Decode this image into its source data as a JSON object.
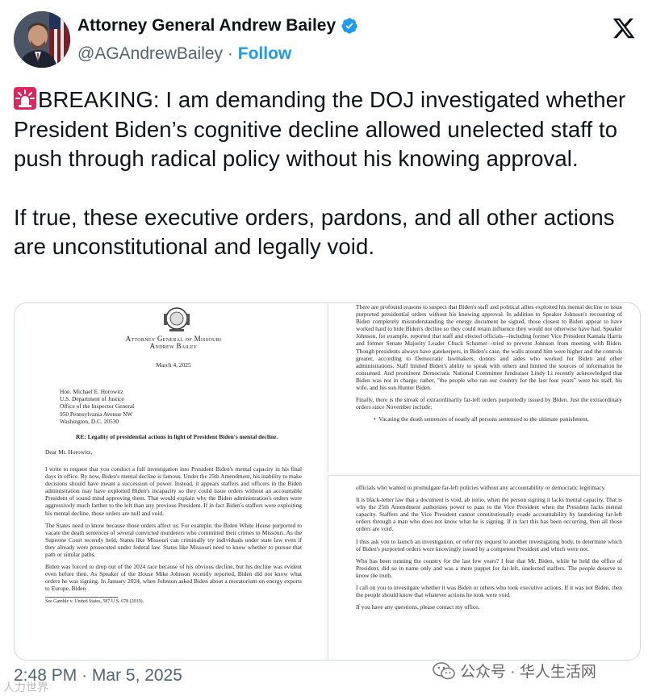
{
  "header": {
    "display_name": "Attorney General Andrew Bailey",
    "handle": "@AGAndrewBailey",
    "separator": "·",
    "follow_label": "Follow"
  },
  "tweet": {
    "paragraph1": "BREAKING: I am demanding the DOJ investigated whether President Biden’s cognitive decline allowed unelected staff to push through radical policy without his knowing approval.",
    "paragraph2": "If true, these executive orders, pardons, and all other actions are unconstitutional and legally void."
  },
  "letter": {
    "office_line1": "Attorney General of Missouri",
    "office_line2": "Andrew Bailey",
    "date": "March 4, 2025",
    "addressee": [
      "Hon. Michael E. Horowitz",
      "U.S. Department of Justice",
      "Office of the Inspector General",
      "950 Pennsylvania Avenue NW",
      "Washington, D.C. 20530"
    ],
    "re_line": "RE: Legality of presidential actions in light of President Biden's mental decline.",
    "salutation": "Dear Mr. Horowitz,",
    "left_paragraphs": [
      "I write to request that you conduct a full investigation into President Biden's mental capacity in his final days in office. By now, Biden's mental decline is famous. Under the 25th Amendment, his inability to make decisions should have meant a succession of power. Instead, it appears staffers and officers in the Biden administration may have exploited Biden's incapacity so they could issue orders without an accountable President of sound mind approving them. That would explain why the Biden administration's orders were aggressively much farther to the left than any previous President. If in fact Biden's staffers were exploiting his mental decline, those orders are null and void.",
      "The States need to know because those orders affect us. For example, the Biden White House purported to vacate the death sentences of several convicted murderers who committed their crimes in Missouri. As the Supreme Court recently held, States like Missouri can criminally try individuals under state law even if they already were prosecuted under federal law. States like Missouri need to know whether to pursue that path or similar paths.",
      "Biden was forced to drop out of the 2024 race because of his obvious decline, but his decline was evident even before then. As Speaker of the House Mike Johnson recently reported, Biden did not know what orders he was signing. In January 2024, when Johnson asked Biden about a moratorium on energy exports to Europe, Biden"
    ],
    "footnote": "See Gamble v. United States, 587 U.S. 678 (2019).",
    "top_right_paragraphs": [
      "There are profound reasons to suspect that Biden's staff and political allies exploited his mental decline to issue purported presidential orders without his knowing approval. In addition to Speaker Johnson's recounting of Biden completely misunderstanding the energy document he signed, those closest to Biden appear to have worked hard to hide Biden's decline so they could retain influence they would not otherwise have had. Speaker Johnson, for example, reported that staff and elected officials—including former Vice President Kamala Harris and former Senate Majority Leader Chuck Schumer—tried to prevent Johnson from meeting with Biden. Though presidents always have gatekeepers, in Biden's case, the walls around him were higher and the controls greater, according to Democratic lawmakers, donors and aides who worked for Biden and other administrations. Staff limited Biden's ability to speak with others and limited the sources of information he consumed. And prominent Democratic National Committee fundraiser Lindy Li recently acknowledged that Biden was not in charge; rather, \"the people who ran our country for the last four years\" were his staff, his wife, and his son Hunter Biden.",
      "Finally, there is the streak of extraordinarily far-left orders purportedly issued by Biden. Just the extraordinary orders since November include:"
    ],
    "bullet": "Vacating the death sentences of nearly all persons sentenced to the ultimate punishment,",
    "bottom_right_paragraphs": [
      "officials who wanted to promulgate far-left policies without any accountability or democratic legitimacy.",
      "It is black-letter law that a document is void, ab initio, when the person signing it lacks mental capacity. That is why the 25th Amendment authorizes power to pass to the Vice President when the President lacks mental capacity. Staffers and the Vice President cannot constitutionally evade accountability by laundering far-left orders through a man who does not know what he is signing. If in fact this has been occurring, then all those orders are void.",
      "I thus ask you to launch an investigation, or refer my request to another investigating body, to determine which of Biden's purported orders were knowingly issued by a competent President and which were not.",
      "Who has been running the country for the last few years? I fear that Mr. Biden, while he held the office of President, did so in name only and was a mere puppet for far-left, unelected staffers. The people deserve to know the truth.",
      "I call on you to investigate whether it was Biden or others who took executive actions. If it was not Biden, then the people should know that whatever actions he took were void.",
      "If you have any questions, please contact my office."
    ]
  },
  "footer": {
    "time": "2:48 PM",
    "separator": "·",
    "date": "Mar 5, 2025"
  },
  "watermark": {
    "text": "公众号 · 华人生活网",
    "corner_text": "人力世界"
  },
  "colors": {
    "accent": "#1d9bf0",
    "muted": "#536471",
    "text": "#0f1419",
    "siren": "#e0245e"
  }
}
